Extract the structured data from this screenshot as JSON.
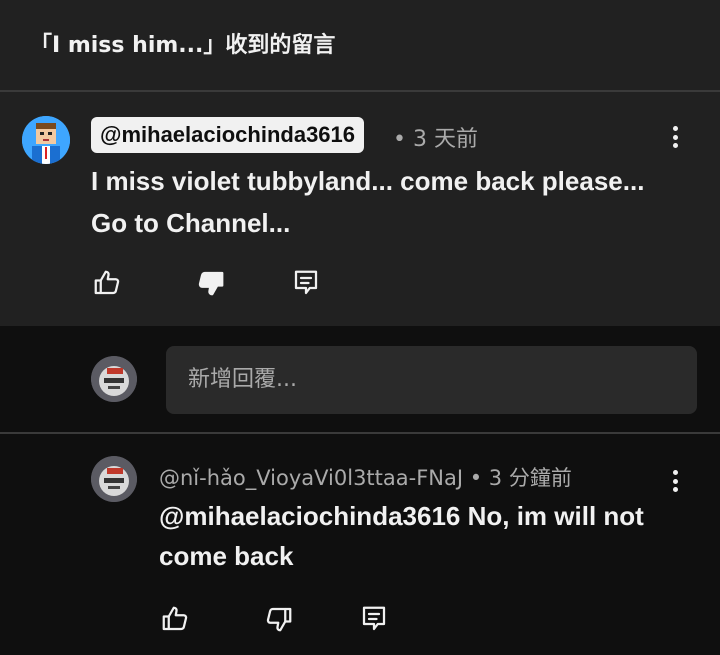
{
  "header": {
    "title": "「I miss him...」收到的留言"
  },
  "comment": {
    "author_handle": "@mihaelaciochinda3616",
    "meta": "• 3 天前",
    "text": "I miss violet tubbyland... come back please... Go to Channel..."
  },
  "reply_box": {
    "placeholder": "新增回覆..."
  },
  "reply": {
    "author_meta": "@nǐ-hǎo_VioyaVi0l3ttaa-FNaJ • 3 分鐘前",
    "text": "@mihaelaciochinda3616 No, im will not come back"
  },
  "icons": {
    "like": "thumbs-up-icon",
    "dislike": "thumbs-down-icon",
    "reply": "reply-icon",
    "more": "more-vert-icon"
  },
  "colors": {
    "background": "#0f0f0f",
    "surface": "#212121",
    "text": "#f1f1f1",
    "secondary_text": "#aaaaaa",
    "avatar_blue": "#3ea6ff"
  }
}
